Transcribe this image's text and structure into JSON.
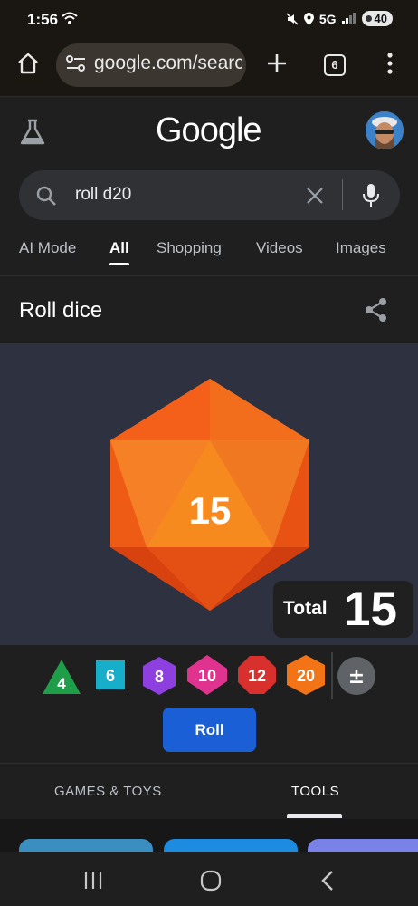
{
  "status_bar": {
    "time": "1:56",
    "network": "5G",
    "battery": "40"
  },
  "browser": {
    "url": "google.com/searc",
    "tab_count": "6"
  },
  "google": {
    "logo": "Google"
  },
  "search": {
    "query": "roll d20"
  },
  "tabs": [
    {
      "label": "AI Mode"
    },
    {
      "label": "All"
    },
    {
      "label": "Shopping"
    },
    {
      "label": "Videos"
    },
    {
      "label": "Images"
    }
  ],
  "result": {
    "title": "Roll dice"
  },
  "dice": {
    "current_value": "15",
    "total_label": "Total",
    "total_value": "15",
    "options": [
      {
        "label": "4",
        "color": "#1e9e48"
      },
      {
        "label": "6",
        "color": "#16aec8"
      },
      {
        "label": "8",
        "color": "#8e3fe0"
      },
      {
        "label": "10",
        "color": "#e0338f"
      },
      {
        "label": "12",
        "color": "#d8302c"
      },
      {
        "label": "20",
        "color": "#f27416"
      },
      {
        "label": "±",
        "color": "#5f6368"
      }
    ],
    "roll_label": "Roll"
  },
  "bottom_tabs": [
    {
      "label": "GAMES & TOYS"
    },
    {
      "label": "TOOLS"
    }
  ],
  "colors": {
    "accent": "#1a5fd6",
    "d20": "#f26a1b"
  }
}
